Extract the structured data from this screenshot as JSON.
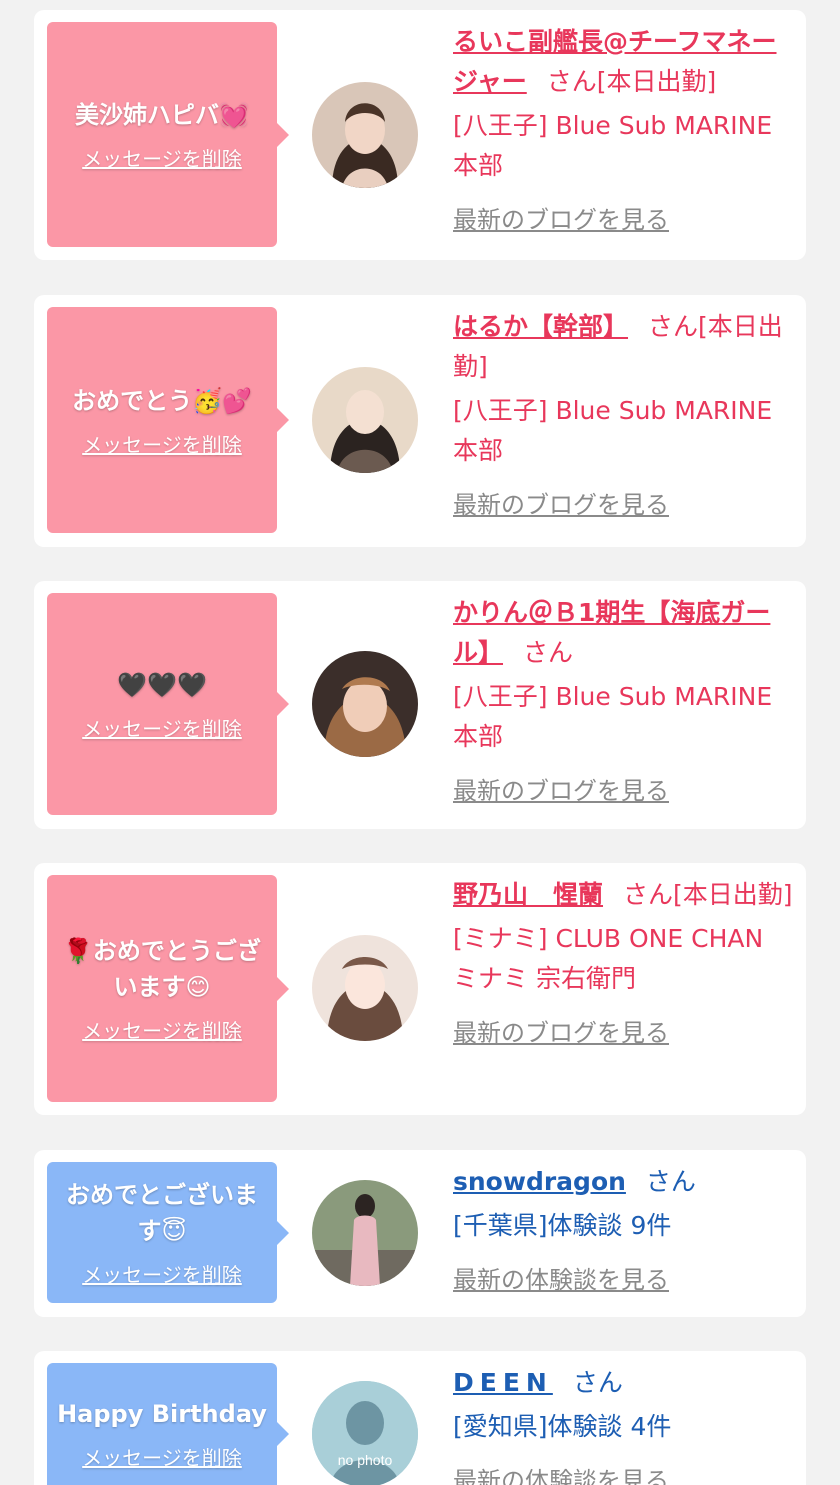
{
  "colors": {
    "pink_bubble": "#fb97a6",
    "blue_bubble": "#8ab7f7",
    "pink_text": "#e8375b",
    "blue_text": "#1d5eb3",
    "link_gray": "#8a8a8a"
  },
  "cards": [
    {
      "message": "美沙姉ハピバ💓",
      "delete_label": "メッセージを削除",
      "name": "るいこ副艦長@チーフマネージャー",
      "suffix": "さん",
      "status": "[本日出勤]",
      "shop": "[八王子] Blue Sub MARINE 本部",
      "more_link": "最新のブログを見る"
    },
    {
      "message": "おめでとう🥳💕",
      "delete_label": "メッセージを削除",
      "name": "はるか【幹部】",
      "suffix": "さん",
      "status": "[本日出勤]",
      "shop": "[八王子] Blue Sub MARINE 本部",
      "more_link": "最新のブログを見る"
    },
    {
      "message": "🖤🖤🖤",
      "delete_label": "メッセージを削除",
      "name": "かりん＠Ｂ1期生【海底ガール】",
      "suffix": "さん",
      "status": "",
      "shop": "[八王子] Blue Sub MARINE 本部",
      "more_link": "最新のブログを見る"
    },
    {
      "message": "🌹おめでとうございます😊",
      "delete_label": "メッセージを削除",
      "name": "野乃山　惺蘭",
      "suffix": "さん",
      "status": "[本日出勤]",
      "shop": "[ミナミ] CLUB ONE CHAN ミナミ 宗右衛門",
      "more_link": "最新のブログを見る"
    },
    {
      "message": "おめでとございます😇",
      "delete_label": "メッセージを削除",
      "name": "snowdragon",
      "suffix": "さん",
      "detail": "[千葉県]体験談 9件",
      "more_link": "最新の体験談を見る"
    },
    {
      "message": "Happy Birthday",
      "delete_label": "メッセージを削除",
      "name": "DEEN",
      "suffix": "さん",
      "detail": "[愛知県]体験談 4件",
      "more_link": "最新の体験談を見る",
      "avatar_placeholder": "no photo"
    }
  ]
}
